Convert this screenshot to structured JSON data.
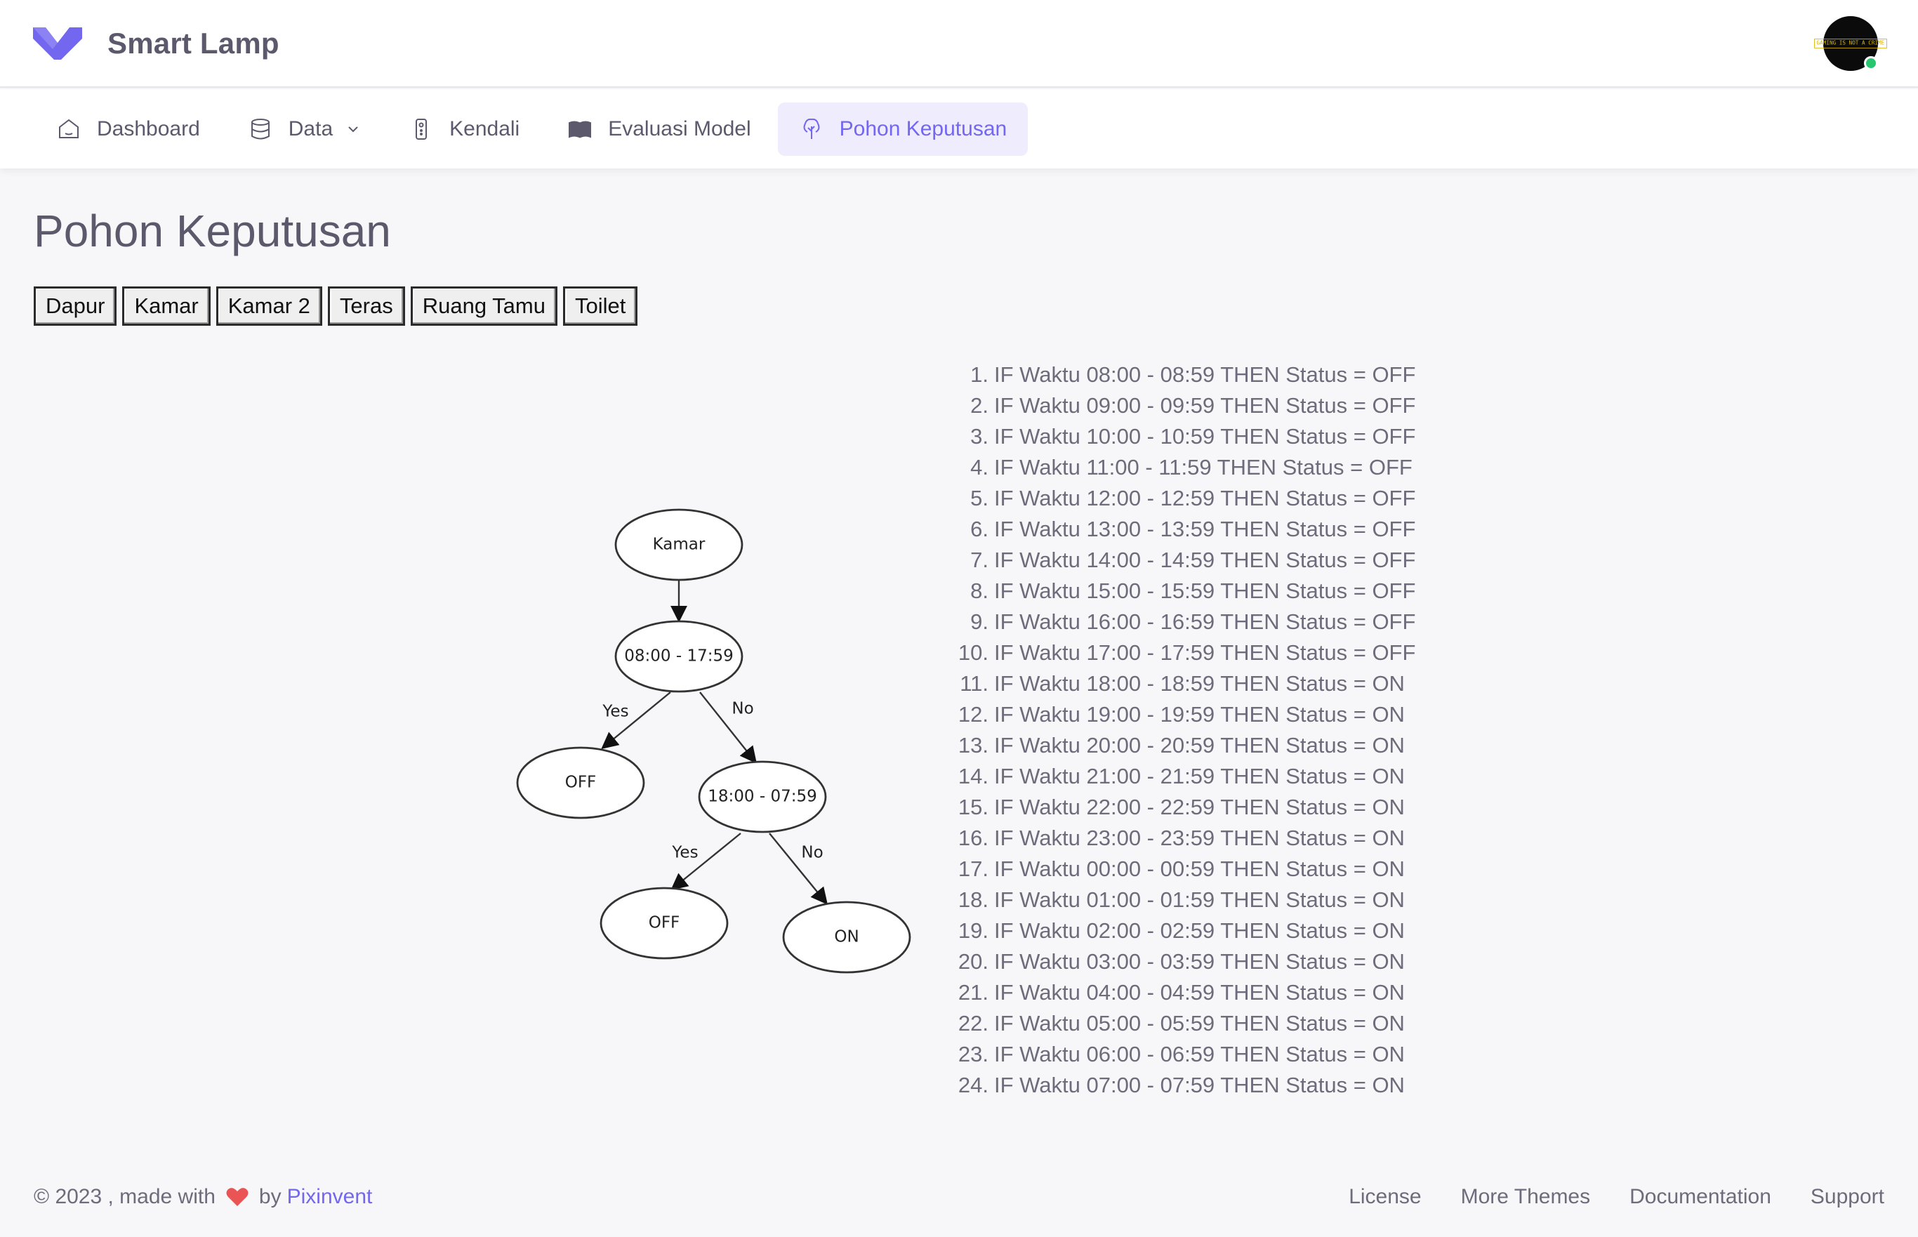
{
  "brand": {
    "name": "Smart Lamp"
  },
  "avatar": {
    "label": "GAMING IS NOT A CRIME"
  },
  "nav": {
    "dashboard": "Dashboard",
    "data": "Data",
    "kendali": "Kendali",
    "evaluasi": "Evaluasi Model",
    "pohon": "Pohon Keputusan"
  },
  "page": {
    "title": "Pohon Keputusan"
  },
  "rooms": [
    "Dapur",
    "Kamar",
    "Kamar 2",
    "Teras",
    "Ruang Tamu",
    "Toilet"
  ],
  "tree": {
    "root": "Kamar",
    "node1": "08:00 - 17:59",
    "node1_yes_leaf": "OFF",
    "node2": "18:00 - 07:59",
    "node2_yes_leaf": "OFF",
    "node2_no_leaf": "ON",
    "yes": "Yes",
    "no": "No"
  },
  "rules": [
    {
      "n": "1.",
      "text": "IF Waktu 08:00 - 08:59 THEN Status = OFF"
    },
    {
      "n": "2.",
      "text": "IF Waktu 09:00 - 09:59 THEN Status = OFF"
    },
    {
      "n": "3.",
      "text": "IF Waktu 10:00 - 10:59 THEN Status = OFF"
    },
    {
      "n": "4.",
      "text": "IF Waktu 11:00 - 11:59 THEN Status = OFF"
    },
    {
      "n": "5.",
      "text": "IF Waktu 12:00 - 12:59 THEN Status = OFF"
    },
    {
      "n": "6.",
      "text": "IF Waktu 13:00 - 13:59 THEN Status = OFF"
    },
    {
      "n": "7.",
      "text": "IF Waktu 14:00 - 14:59 THEN Status = OFF"
    },
    {
      "n": "8.",
      "text": "IF Waktu 15:00 - 15:59 THEN Status = OFF"
    },
    {
      "n": "9.",
      "text": "IF Waktu 16:00 - 16:59 THEN Status = OFF"
    },
    {
      "n": "10.",
      "text": "IF Waktu 17:00 - 17:59 THEN Status = OFF"
    },
    {
      "n": "11.",
      "text": "IF Waktu 18:00 - 18:59 THEN Status = ON"
    },
    {
      "n": "12.",
      "text": "IF Waktu 19:00 - 19:59 THEN Status = ON"
    },
    {
      "n": "13.",
      "text": "IF Waktu 20:00 - 20:59 THEN Status = ON"
    },
    {
      "n": "14.",
      "text": "IF Waktu 21:00 - 21:59 THEN Status = ON"
    },
    {
      "n": "15.",
      "text": "IF Waktu 22:00 - 22:59 THEN Status = ON"
    },
    {
      "n": "16.",
      "text": "IF Waktu 23:00 - 23:59 THEN Status = ON"
    },
    {
      "n": "17.",
      "text": "IF Waktu 00:00 - 00:59 THEN Status = ON"
    },
    {
      "n": "18.",
      "text": "IF Waktu 01:00 - 01:59 THEN Status = ON"
    },
    {
      "n": "19.",
      "text": "IF Waktu 02:00 - 02:59 THEN Status = ON"
    },
    {
      "n": "20.",
      "text": "IF Waktu 03:00 - 03:59 THEN Status = ON"
    },
    {
      "n": "21.",
      "text": "IF Waktu 04:00 - 04:59 THEN Status = ON"
    },
    {
      "n": "22.",
      "text": "IF Waktu 05:00 - 05:59 THEN Status = ON"
    },
    {
      "n": "23.",
      "text": "IF Waktu 06:00 - 06:59 THEN Status = ON"
    },
    {
      "n": "24.",
      "text": "IF Waktu 07:00 - 07:59 THEN Status = ON"
    }
  ],
  "footer": {
    "copyright": "© 2023 , made with",
    "by": "by",
    "author": "Pixinvent",
    "links": [
      "License",
      "More Themes",
      "Documentation",
      "Support"
    ]
  },
  "colors": {
    "primary": "#7367f0",
    "text": "#5d596c",
    "muted": "#6e6b7b",
    "background": "#f7f7f9",
    "heart": "#ea5455",
    "online": "#28c76f"
  },
  "icons": {
    "brand": "vuexy-logo-icon",
    "dashboard": "home-icon",
    "data": "database-icon",
    "kendali": "remote-control-icon",
    "evaluasi": "book-icon",
    "pohon": "tree-icon",
    "caret": "chevron-down-icon",
    "heart": "heart-icon"
  }
}
